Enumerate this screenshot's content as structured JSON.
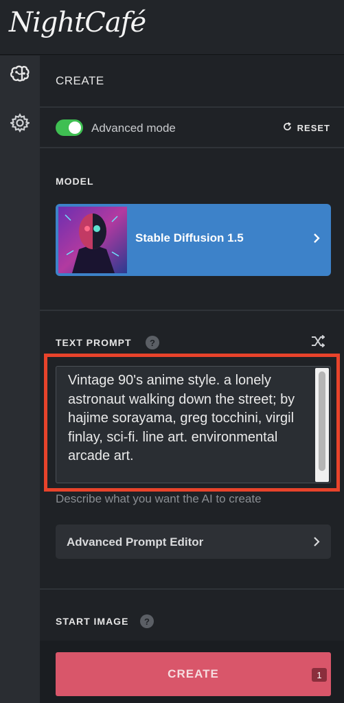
{
  "app": {
    "logo_text": "NightCafé"
  },
  "rail": {
    "items": [
      {
        "icon": "brain-icon"
      },
      {
        "icon": "gear-icon"
      }
    ]
  },
  "create": {
    "title": "CREATE",
    "advanced_mode": {
      "label": "Advanced mode",
      "enabled": true
    },
    "reset_label": "RESET",
    "model": {
      "section_label": "MODEL",
      "name": "Stable Diffusion 1.5"
    },
    "text_prompt": {
      "section_label": "TEXT PROMPT",
      "help": "?",
      "value": "Vintage 90's anime style. a lonely astronaut walking down the street; by hajime sorayama, greg tocchini, virgil finlay, sci-fi. line art. environmental arcade art.",
      "hint": "Describe what you want the AI to create"
    },
    "advanced_prompt_editor": "Advanced Prompt Editor",
    "start_image": {
      "section_label": "START IMAGE",
      "help": "?"
    },
    "create_button": {
      "label": "CREATE",
      "badge": "1"
    }
  },
  "colors": {
    "accent_green": "#3fbf52",
    "model_card_blue": "#3d82c9",
    "highlight_red": "#e8432b",
    "create_pink": "#d9566a"
  }
}
